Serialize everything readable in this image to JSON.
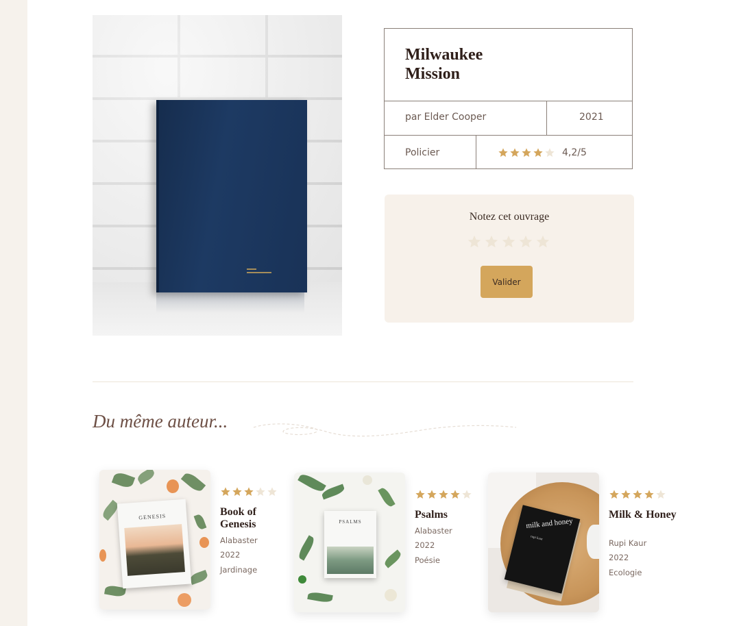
{
  "colors": {
    "accent": "#d4a65c",
    "star_filled": "#d4a65c",
    "star_empty": "#eee5d6",
    "panel_bg": "#f7f1ea",
    "book_cover": "#1d3a63"
  },
  "book": {
    "title": "Milwaukee Mission",
    "author": "par Elder Cooper",
    "year": "2021",
    "genre": "Policier",
    "rating_value": 4.2,
    "rating_text": "4,2/5",
    "image_icon": "book-photo"
  },
  "rate": {
    "title": "Notez cet ouvrage",
    "star_count": 5,
    "button_label": "Valider"
  },
  "related": {
    "heading": "Du même auteur...",
    "items": [
      {
        "title": "Book of Genesis",
        "author": "Alabaster",
        "year": "2022",
        "genre": "Jardinage",
        "rating": 3,
        "cover_label": "GENESIS"
      },
      {
        "title": "Psalms",
        "author": "Alabaster",
        "year": "2022",
        "genre": "Poésie",
        "rating": 4,
        "cover_label": "PSALMS"
      },
      {
        "title": "Milk & Honey",
        "author": "Rupi Kaur",
        "year": "2022",
        "genre": "Ecologie",
        "rating": 4,
        "cover_label": "milk and honey",
        "cover_sub": "rupi kaur"
      }
    ]
  }
}
